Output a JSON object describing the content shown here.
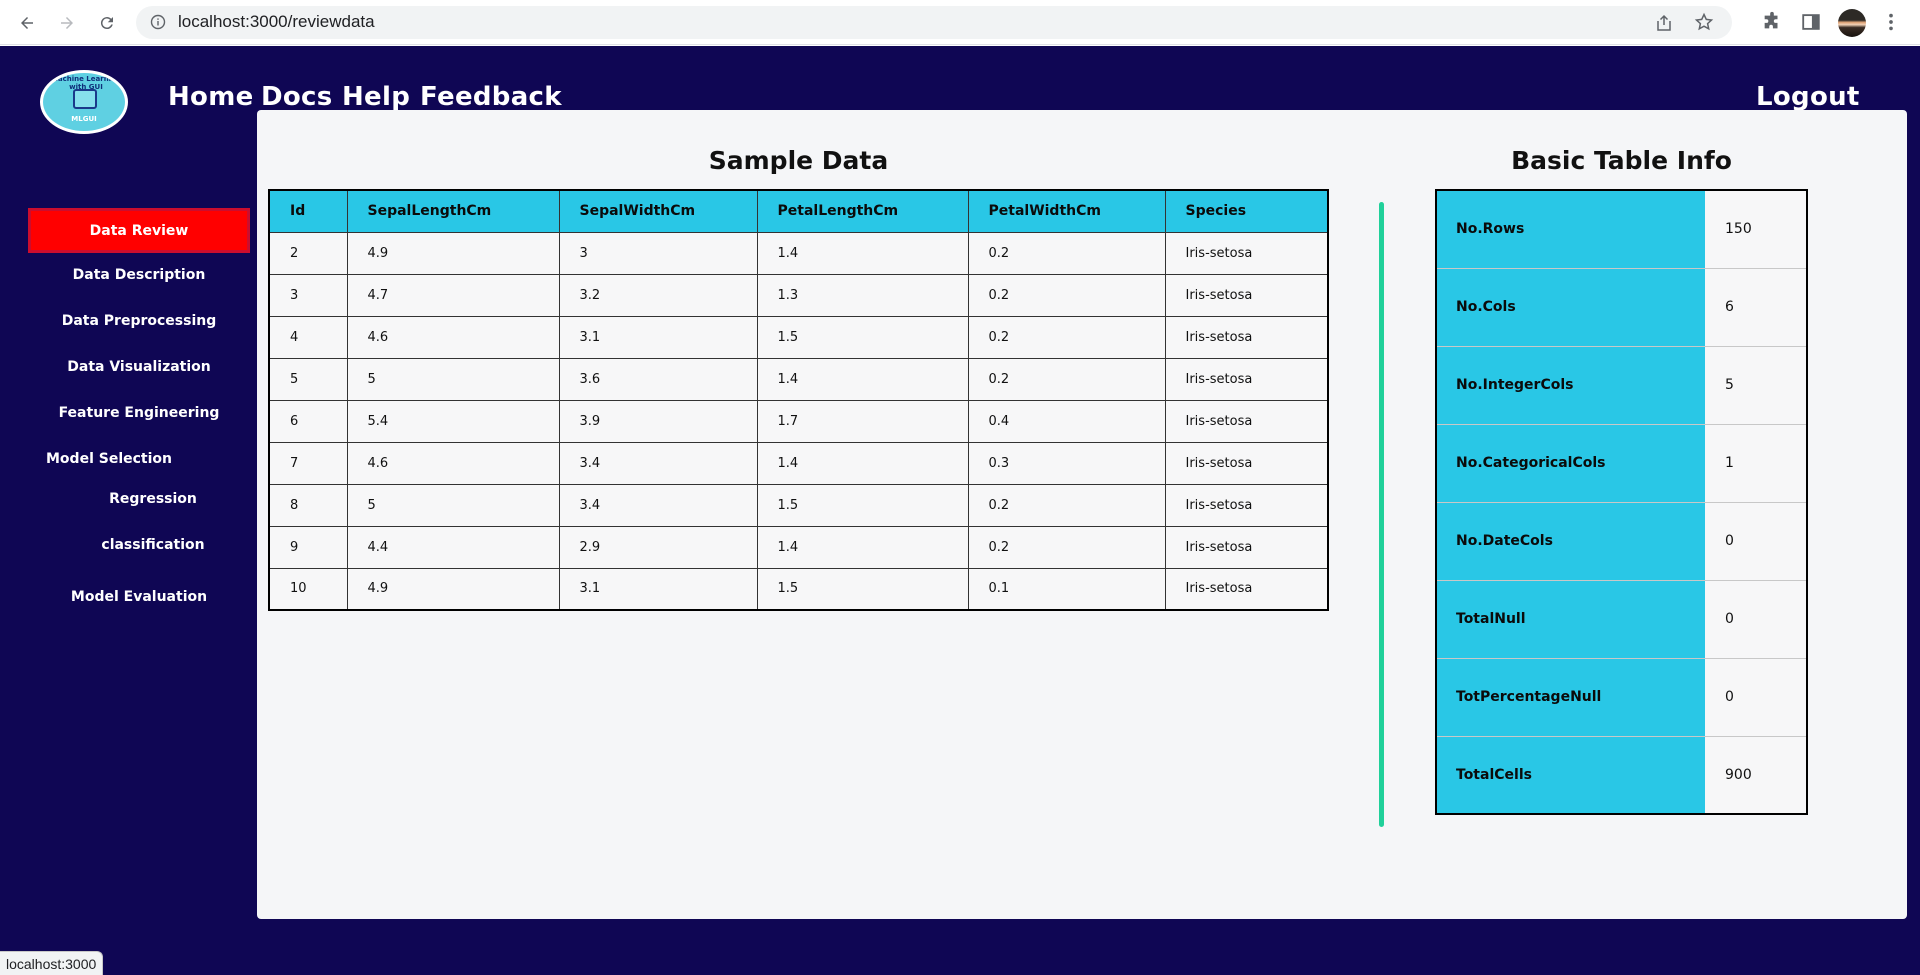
{
  "browser": {
    "url": "localhost:3000/reviewdata",
    "status_text": "localhost:3000"
  },
  "header": {
    "nav": [
      "Home",
      "Docs",
      "Help",
      "Feedback"
    ],
    "logout_label": "Logout",
    "logo_ring_text": "Machine Learning with GUI",
    "logo_abbr": "MLGUI"
  },
  "sidebar": {
    "active_label": "Data Review",
    "items": [
      "Data Description",
      "Data Preprocessing",
      "Data Visualization",
      "Feature Engineering"
    ],
    "model_selection_label": "Model Selection",
    "sub_items": [
      "Regression",
      "classification"
    ],
    "evaluation_label": "Model Evaluation"
  },
  "sample": {
    "title": "Sample Data",
    "columns": [
      "Id",
      "SepalLengthCm",
      "SepalWidthCm",
      "PetalLengthCm",
      "PetalWidthCm",
      "Species"
    ],
    "rows": [
      [
        "2",
        "4.9",
        "3",
        "1.4",
        "0.2",
        "Iris-setosa"
      ],
      [
        "3",
        "4.7",
        "3.2",
        "1.3",
        "0.2",
        "Iris-setosa"
      ],
      [
        "4",
        "4.6",
        "3.1",
        "1.5",
        "0.2",
        "Iris-setosa"
      ],
      [
        "5",
        "5",
        "3.6",
        "1.4",
        "0.2",
        "Iris-setosa"
      ],
      [
        "6",
        "5.4",
        "3.9",
        "1.7",
        "0.4",
        "Iris-setosa"
      ],
      [
        "7",
        "4.6",
        "3.4",
        "1.4",
        "0.3",
        "Iris-setosa"
      ],
      [
        "8",
        "5",
        "3.4",
        "1.5",
        "0.2",
        "Iris-setosa"
      ],
      [
        "9",
        "4.4",
        "2.9",
        "1.4",
        "0.2",
        "Iris-setosa"
      ],
      [
        "10",
        "4.9",
        "3.1",
        "1.5",
        "0.1",
        "Iris-setosa"
      ]
    ]
  },
  "info": {
    "title": "Basic Table Info",
    "rows": [
      [
        "No.Rows",
        "150"
      ],
      [
        "No.Cols",
        "6"
      ],
      [
        "No.IntegerCols",
        "5"
      ],
      [
        "No.CategoricalCols",
        "1"
      ],
      [
        "No.DateCols",
        "0"
      ],
      [
        "TotalNull",
        "0"
      ],
      [
        "TotPercentageNull",
        "0"
      ],
      [
        "TotalCells",
        "900"
      ]
    ]
  },
  "colors": {
    "app_bg": "#0f0654",
    "active_item": "#ff0000",
    "table_header": "#29c7e6",
    "divider": "#20d09a"
  }
}
